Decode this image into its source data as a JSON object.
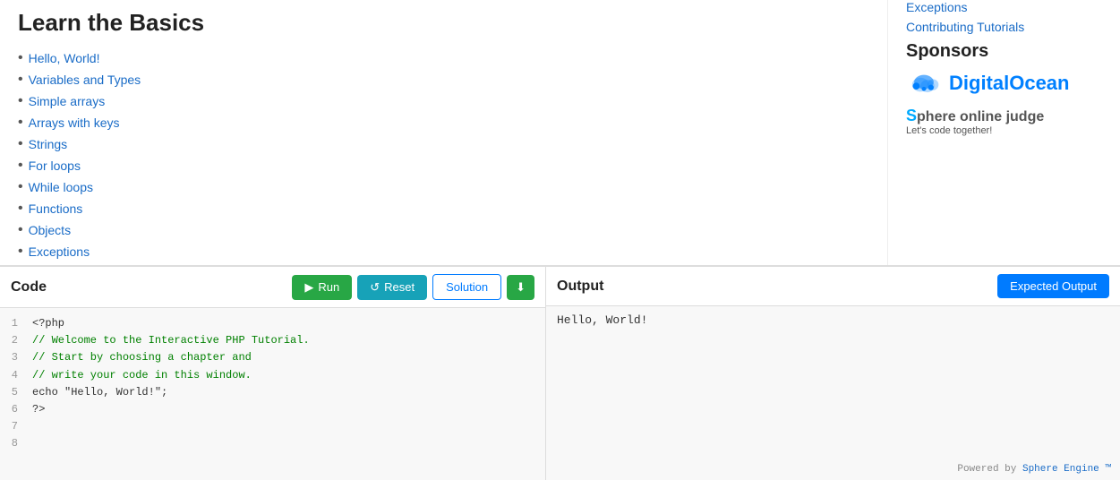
{
  "page": {
    "title": "Learn the Basics"
  },
  "tutorial_list": {
    "items": [
      {
        "label": "Hello, World!",
        "href": "#"
      },
      {
        "label": "Variables and Types",
        "href": "#"
      },
      {
        "label": "Simple arrays",
        "href": "#"
      },
      {
        "label": "Arrays with keys",
        "href": "#"
      },
      {
        "label": "Strings",
        "href": "#"
      },
      {
        "label": "For loops",
        "href": "#"
      },
      {
        "label": "While loops",
        "href": "#"
      },
      {
        "label": "Functions",
        "href": "#"
      },
      {
        "label": "Objects",
        "href": "#"
      },
      {
        "label": "Exceptions",
        "href": "#"
      }
    ]
  },
  "sidebar": {
    "exceptions_link": "Exceptions",
    "contributing_link": "Contributing Tutorials",
    "sponsors_title": "Sponsors",
    "digital_ocean_name": "DigitalOcean",
    "sphere_name": "phere online judge",
    "sphere_tagline": "Let's code together!"
  },
  "code_panel": {
    "title": "Code",
    "run_label": "Run",
    "reset_label": "Reset",
    "solution_label": "Solution",
    "lines": [
      {
        "num": "1",
        "content": "<?php",
        "type": "normal"
      },
      {
        "num": "2",
        "content": "// Welcome to the Interactive PHP Tutorial.",
        "type": "comment"
      },
      {
        "num": "3",
        "content": "// Start by choosing a chapter and",
        "type": "comment"
      },
      {
        "num": "4",
        "content": "// write your code in this window.",
        "type": "comment"
      },
      {
        "num": "5",
        "content": "",
        "type": "normal"
      },
      {
        "num": "6",
        "content": "echo \"Hello, World!\";",
        "type": "normal"
      },
      {
        "num": "7",
        "content": "?>",
        "type": "normal"
      },
      {
        "num": "8",
        "content": "",
        "type": "normal"
      }
    ]
  },
  "output_panel": {
    "title": "Output",
    "expected_label": "Expected Output",
    "output_text": "Hello, World!",
    "powered_by_text": "Powered by ",
    "powered_by_link": "Sphere Engine ™"
  }
}
